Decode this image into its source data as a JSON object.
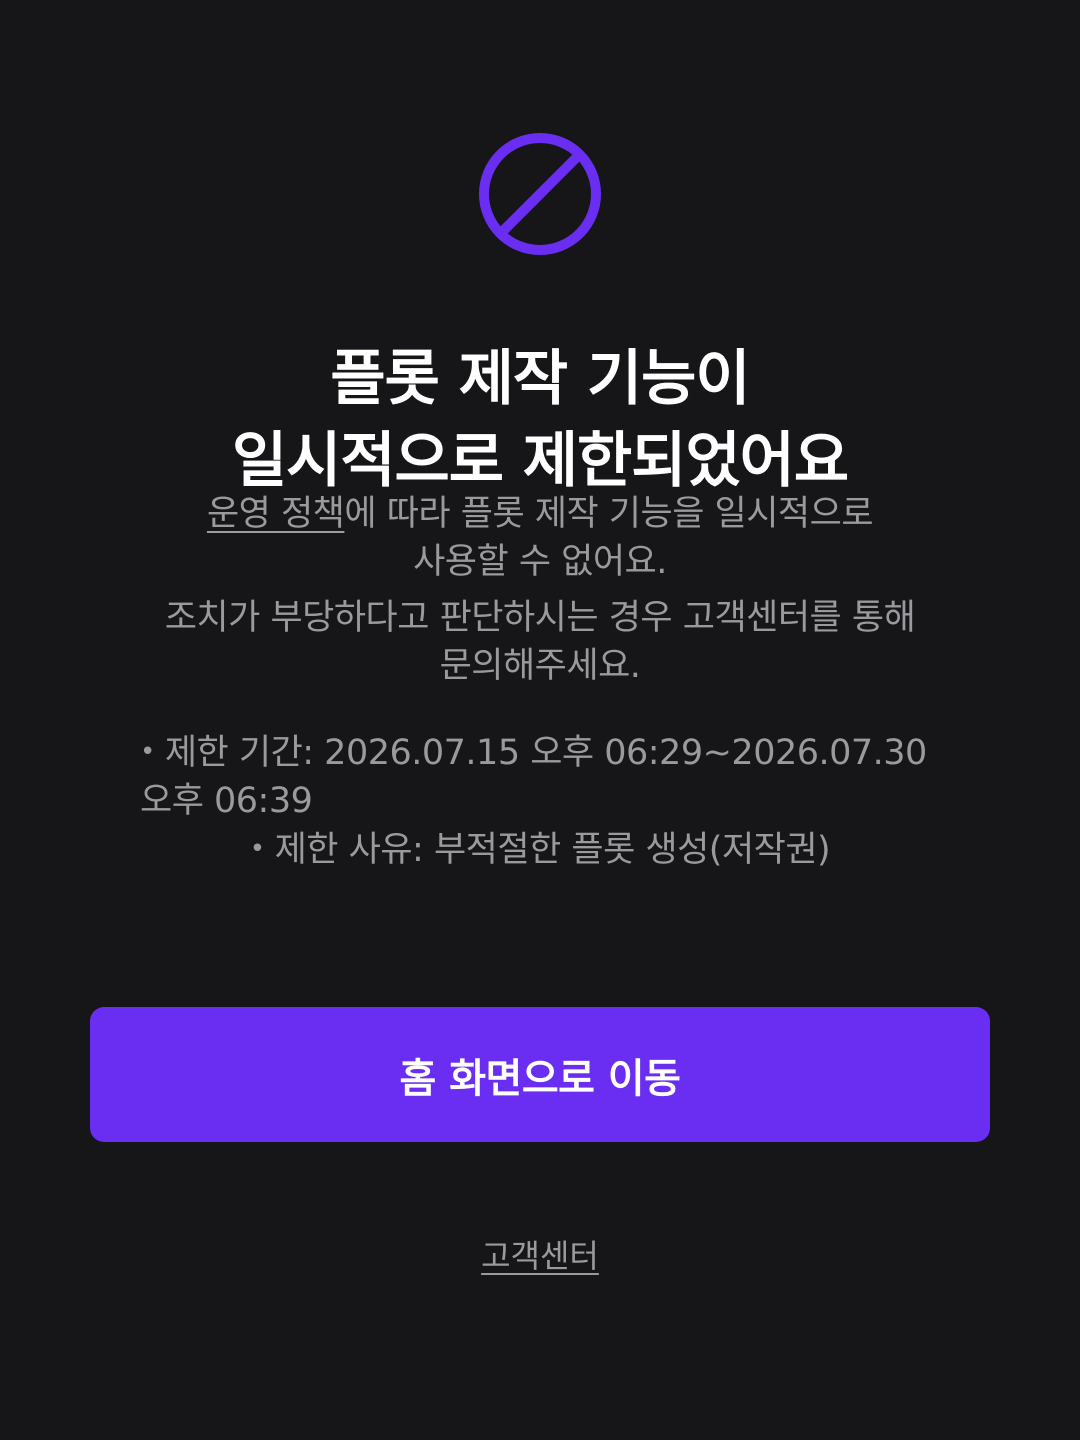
{
  "icon": {
    "name": "prohibited-icon",
    "color": "#6a2df2"
  },
  "title": {
    "line1": "플롯 제작 기능이",
    "line2": "일시적으로 제한되었어요"
  },
  "description": {
    "policy_link": "운영 정책",
    "line1_rest": "에 따라 플롯 제작 기능을 일시적으로",
    "line2": "사용할 수 없어요.",
    "line3": "조치가 부당하다고 판단하시는 경우 고객센터를 통해",
    "line4": "문의해주세요."
  },
  "details": {
    "bullet": "•",
    "period_line1": "제한 기간: 2026.07.15 오후 06:29~2026.07.30",
    "period_line2": "오후 06:39",
    "reason": "제한 사유: 부적절한 플롯 생성(저작권)"
  },
  "home_button": {
    "label": "홈 화면으로 이동",
    "color": "#6a2df2"
  },
  "support": {
    "label": "고객센터"
  },
  "colors": {
    "background": "#161618",
    "text_primary": "#ffffff",
    "text_secondary": "#9a9a9e",
    "accent": "#6a2df2"
  }
}
